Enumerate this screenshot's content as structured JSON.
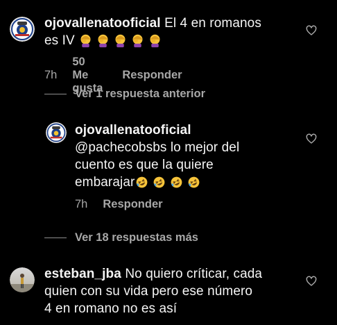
{
  "comments": [
    {
      "username": "ojovallenatooficial",
      "text_line1": "El 4 en romanos",
      "text_line2_prefix": "es IV",
      "emoji_set": "facepalm-emoji x5",
      "time": "7h",
      "likes": "50 Me gusta",
      "reply": "Responder"
    }
  ],
  "thread1": {
    "label": "Ver 1 respuesta anterior"
  },
  "reply": {
    "username": "ojovallenatooficial",
    "mention": "@pachecobsbs",
    "text_line1_rest": "lo mejor del",
    "text_line2": "cuento es que la quiere",
    "text_line3_prefix": "embarajar",
    "emoji_set": "rofl-emoji x4",
    "time": "7h",
    "reply": "Responder"
  },
  "thread2": {
    "label": "Ver 18 respuestas más"
  },
  "comment2": {
    "username": "esteban_jba",
    "text_line1_rest": "No quiero críticar, cada",
    "text_line2": "quien con su vida pero ese número",
    "text_line3": "4 en romano no es así"
  },
  "colors": {
    "background": "#000000",
    "primary_text": "#f5f5f5",
    "secondary_text": "#a8a8a8"
  }
}
